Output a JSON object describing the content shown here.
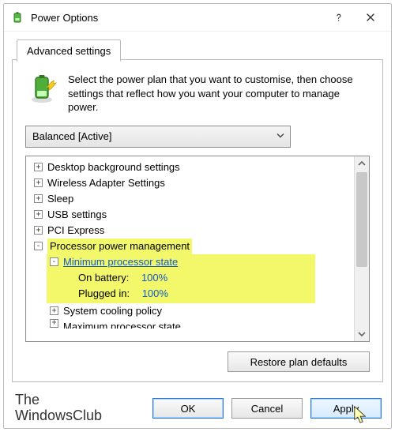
{
  "window": {
    "title": "Power Options"
  },
  "tab": {
    "label": "Advanced settings"
  },
  "intro_text": "Select the power plan that you want to customise, then choose settings that reflect how you want your computer to manage power.",
  "combo": {
    "selected": "Balanced [Active]"
  },
  "tree": {
    "items": [
      {
        "label": "Desktop background settings",
        "glyph": "+"
      },
      {
        "label": "Wireless Adapter Settings",
        "glyph": "+"
      },
      {
        "label": "Sleep",
        "glyph": "+"
      },
      {
        "label": "USB settings",
        "glyph": "+"
      },
      {
        "label": "PCI Express",
        "glyph": "+"
      }
    ],
    "processor": {
      "label": "Processor power management",
      "glyph": "-",
      "minstate": {
        "label": "Minimum processor state",
        "glyph": "-",
        "on_battery_label": "On battery:",
        "on_battery_value": "100%",
        "plugged_in_label": "Plugged in:",
        "plugged_in_value": "100%"
      },
      "cooling": {
        "label": "System cooling policy",
        "glyph": "+"
      },
      "maxstate": {
        "label": "Maximum processor state",
        "glyph": "+"
      }
    }
  },
  "restore_btn": "Restore plan defaults",
  "buttons": {
    "ok": "OK",
    "cancel": "Cancel",
    "apply": "Apply"
  },
  "brand": {
    "line1": "The",
    "line2": "WindowsClub"
  }
}
